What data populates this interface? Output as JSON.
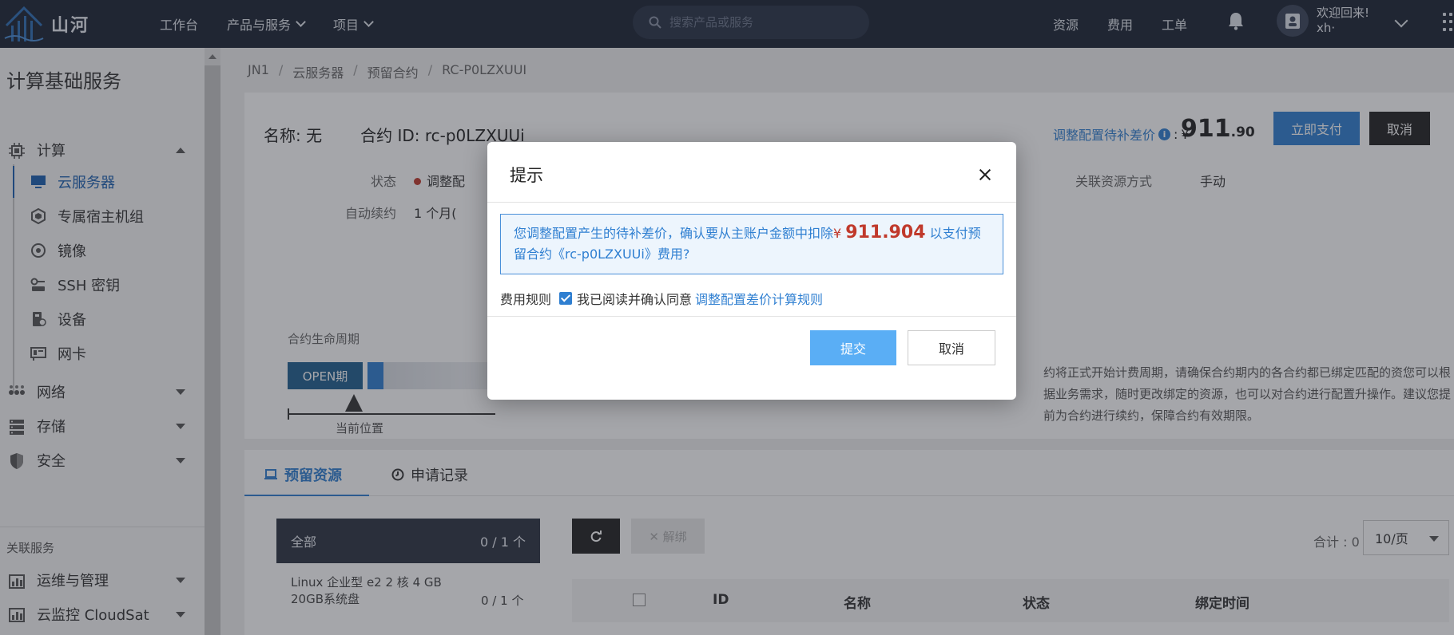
{
  "topbar": {
    "logo_text": "山河",
    "nav": [
      "工作台",
      "产品与服务",
      "项目"
    ],
    "search_placeholder": "搜索产品或服务",
    "right_nav": [
      "资源",
      "费用",
      "工单"
    ],
    "user_greeting": "欢迎回来!",
    "user_name": "xh·"
  },
  "sidebar": {
    "title": "计算基础服务",
    "compute_label": "计算",
    "items": [
      "云服务器",
      "专属宿主机组",
      "镜像",
      "SSH 密钥",
      "设备",
      "网卡"
    ],
    "network_label": "网络",
    "storage_label": "存储",
    "security_label": "安全",
    "assoc_label": "关联服务",
    "ops_label": "运维与管理",
    "monitor_label": "云监控 CloudSat"
  },
  "breadcrumb": [
    "JN1",
    "云服务器",
    "预留合约",
    "RC-P0LZXUUI"
  ],
  "detail": {
    "name": "名称: 无",
    "contract_id": "合约 ID: rc-p0LZXUUi",
    "status_label": "状态",
    "status_value": "调整配",
    "auto_renew_label": "自动续约",
    "auto_renew_value": "1 个月(",
    "assoc_method_label": "关联资源方式",
    "assoc_method_value": "手动",
    "diff_label": "调整配置待补差价",
    "currency": "¥",
    "price_int": "911",
    "price_dec": ".90",
    "pay_button": "立即支付",
    "cancel_button": "取消"
  },
  "lifecycle": {
    "title": "合约生命周期",
    "open_tag": "OPEN期",
    "current_pos": "当前位置",
    "desc": "约将正式开始计费周期，请确保合约期内的各合约都已绑定匹配的资您可以根据业务需求，随时更改绑定的资源，也可以对合约进行配置升操作。建议您提前为合约进行续约，保障合约有效期限。"
  },
  "tabs": [
    "预留资源",
    "申请记录"
  ],
  "resources": {
    "all_label": "全部",
    "all_count": "0 / 1 个",
    "item_line1": "Linux  企业型 e2  2 核  4 GB",
    "item_line2": "20GB系统盘",
    "item_count": "0 / 1 个",
    "unbind_label": "解绑",
    "total": "合计 : 0",
    "page_size": "10/页",
    "columns": [
      "ID",
      "名称",
      "状态",
      "绑定时间"
    ]
  },
  "dialog": {
    "title": "提示",
    "message_pre": "您调整配置产生的待补差价，确认要从主账户金额中扣除",
    "currency": "¥",
    "amount": "911.904",
    "message_post": "以支付预留合约《rc-p0LZXUUi》费用?",
    "rule_label": "费用规则",
    "agree_text": "我已阅读并确认同意",
    "rule_link": "调整配置差价计算规则",
    "submit": "提交",
    "cancel": "取消"
  },
  "colors": {
    "accent": "#2f7fd1",
    "topbar": "#1b2333",
    "danger": "#c0392b"
  }
}
